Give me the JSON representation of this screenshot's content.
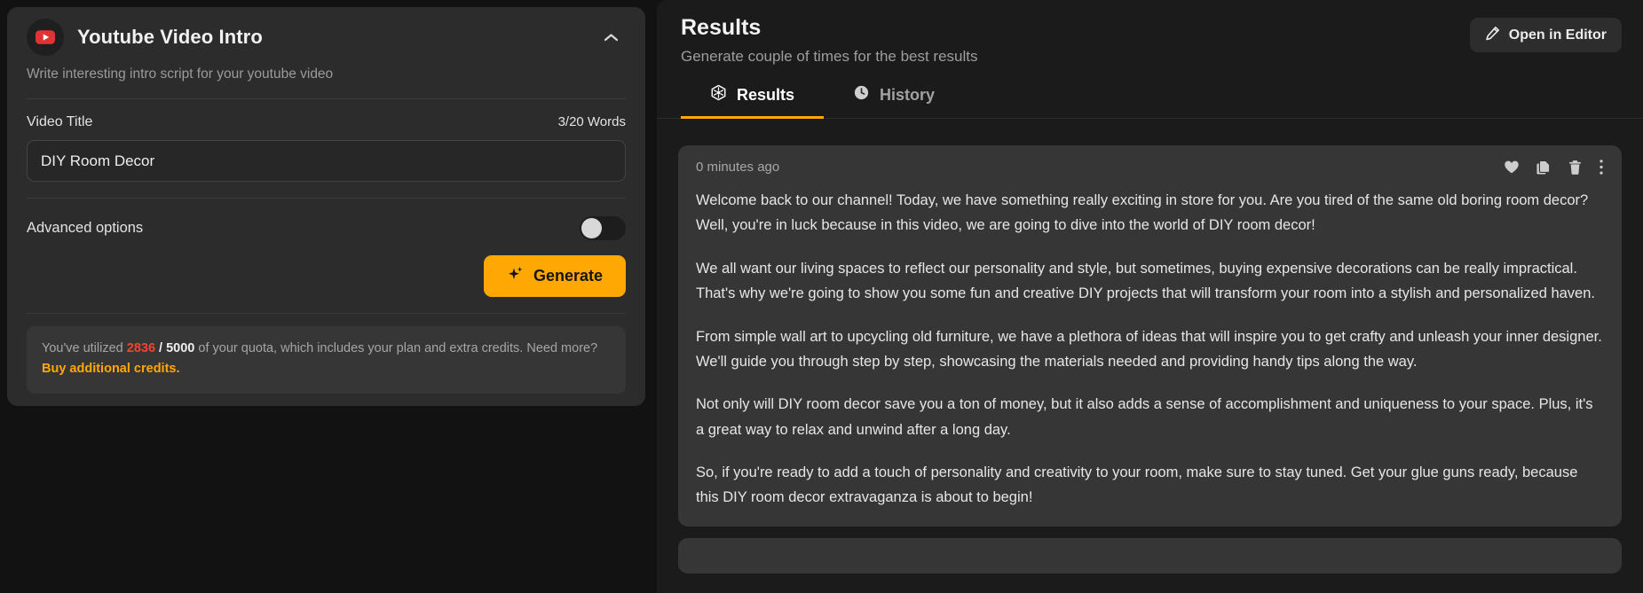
{
  "form": {
    "icon": "youtube-icon",
    "title": "Youtube Video Intro",
    "subtitle": "Write interesting intro script for your youtube video",
    "collapse_icon": "chevron-up-icon",
    "field": {
      "label": "Video Title",
      "word_count": "3/20 Words",
      "value": "DIY Room Decor",
      "placeholder": "Video Title"
    },
    "advanced_label": "Advanced options",
    "advanced_enabled": false,
    "generate_label": "Generate",
    "generate_icon": "sparkles-icon",
    "quota": {
      "prefix": "You've utilized ",
      "used": "2836",
      "separator": " / ",
      "total": "5000",
      "middle": " of your quota, which includes your plan and extra credits. Need more? ",
      "link": "Buy additional credits."
    }
  },
  "results": {
    "title": "Results",
    "subtitle": "Generate couple of times for the best results",
    "open_editor_label": "Open in Editor",
    "open_editor_icon": "pencil-icon",
    "tabs": [
      {
        "label": "Results",
        "icon": "cube-icon",
        "active": true
      },
      {
        "label": "History",
        "icon": "clock-icon",
        "active": false
      }
    ],
    "card": {
      "timestamp": "0 minutes ago",
      "actions": [
        {
          "name": "favorite-icon",
          "label": "Favorite"
        },
        {
          "name": "copy-icon",
          "label": "Copy"
        },
        {
          "name": "trash-icon",
          "label": "Delete"
        },
        {
          "name": "more-vertical-icon",
          "label": "More"
        }
      ],
      "paragraphs": [
        "Welcome back to our channel! Today, we have something really exciting in store for you. Are you tired of the same old boring room decor? Well, you're in luck because in this video, we are going to dive into the world of DIY room decor!",
        "We all want our living spaces to reflect our personality and style, but sometimes, buying expensive decorations can be really impractical. That's why we're going to show you some fun and creative DIY projects that will transform your room into a stylish and personalized haven.",
        "From simple wall art to upcycling old furniture, we have a plethora of ideas that will inspire you to get crafty and unleash your inner designer. We'll guide you through step by step, showcasing the materials needed and providing handy tips along the way.",
        "Not only will DIY room decor save you a ton of money, but it also adds a sense of accomplishment and uniqueness to your space. Plus, it's a great way to relax and unwind after a long day.",
        "So, if you're ready to add a touch of personality and creativity to your room, make sure to stay tuned. Get your glue guns ready, because this DIY room decor extravaganza is about to begin!"
      ]
    }
  },
  "colors": {
    "accent": "#ffa803",
    "panel": "#2c2c2c",
    "card": "#363636",
    "background": "#121212",
    "right_panel": "#1b1b1b",
    "quota_used": "#f0452f",
    "youtube_red": "#e03434"
  }
}
